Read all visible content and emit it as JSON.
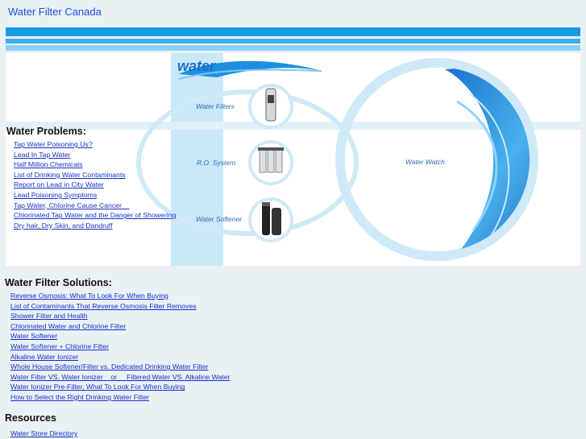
{
  "site_title": "Water Filter Canada",
  "banner": {
    "logo_text": "water",
    "labels": {
      "water_filters": "Water Filters",
      "ro_system": "R.O. System",
      "water_softener": "Water Softener",
      "water_watch": "Water Watch"
    }
  },
  "problems": {
    "heading": "Water Problems:",
    "links": [
      "Tap Water Poisoning Us?",
      "Lead In Tap Water",
      "Half Million Chemicals",
      "List of Drinking Water Contaminants",
      "Report on Lead in City Water",
      "Lead Poisoning Symptoms",
      "Tap Water, Chlorine Cause Cancer    ",
      "Chlorinated Tap Water and the Danger of Showering",
      "Dry hair, Dry Skin, and Dandruff"
    ]
  },
  "solutions": {
    "heading": "Water Filter Solutions:",
    "links": [
      "Reverse Osmosis: What To Look For When Buying",
      "List of Contaminants That Reverse Osmosis Filter Removes",
      "Shower Filter and Health",
      "Chlorinated Water and Chlorine Filter",
      "Water Softener",
      "Water Softener + Chlorine Filter",
      "Alkaline Water Ionizer",
      "Whole House Softener/Filter vs. Dedicated Drinking Water Filter",
      "Water Filter VS. Water Ionizer    or     Filtered Water VS. Alkaline Water",
      "Water Ionizer Pre-Filter, What To Look For When Buying",
      "How to Select the Right Drinking Water Filter"
    ]
  },
  "resources": {
    "heading": "Resources",
    "links": [
      "Water Store Directory"
    ]
  },
  "colors": {
    "link": "#1530c8",
    "title": "#1f4fd8",
    "bar_dark": "#1a9ae6",
    "bar_mid": "#3eaeee",
    "bar_light": "#8fd0f6",
    "page_bg": "#eaf1f5"
  }
}
